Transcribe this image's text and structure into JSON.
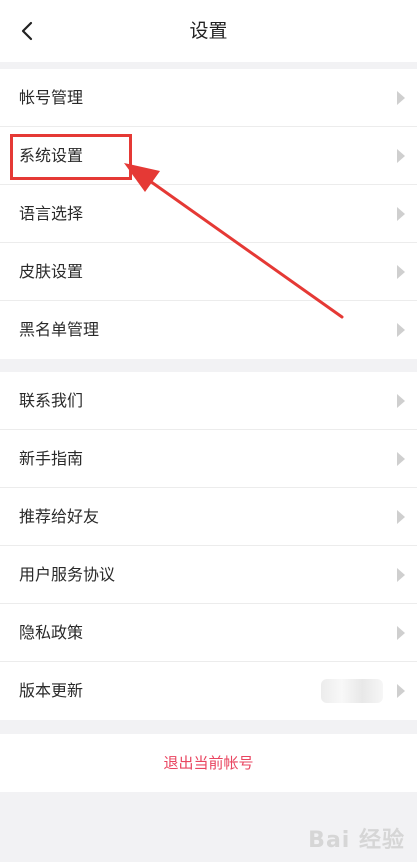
{
  "header": {
    "title": "设置"
  },
  "group1": [
    {
      "label": "帐号管理"
    },
    {
      "label": "系统设置"
    },
    {
      "label": "语言选择"
    },
    {
      "label": "皮肤设置"
    },
    {
      "label": "黑名单管理"
    }
  ],
  "group2": [
    {
      "label": "联系我们"
    },
    {
      "label": "新手指南"
    },
    {
      "label": "推荐给好友"
    },
    {
      "label": "用户服务协议"
    },
    {
      "label": "隐私政策"
    },
    {
      "label": "版本更新"
    }
  ],
  "footer": {
    "logout": "退出当前帐号"
  },
  "colors": {
    "accent": "#e94560",
    "annotation": "#e53935"
  },
  "icons": {
    "back": "chevron-left-icon",
    "row": "chevron-right-icon"
  }
}
